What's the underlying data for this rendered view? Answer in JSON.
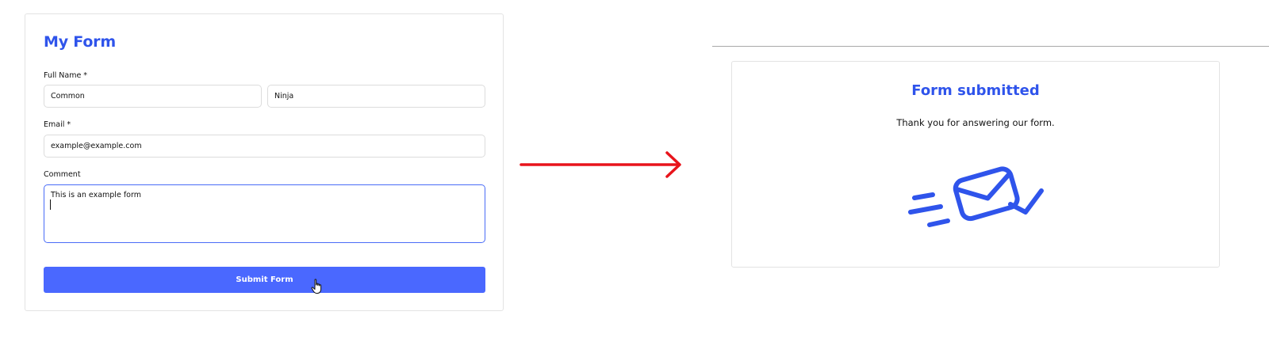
{
  "form": {
    "title": "My Form",
    "full_name_label": "Full Name *",
    "first_name_value": "Common",
    "last_name_value": "Ninja",
    "email_label": "Email *",
    "email_value": "example@example.com",
    "comment_label": "Comment",
    "comment_value": "This is an example form",
    "submit_label": "Submit Form"
  },
  "success": {
    "title": "Form submitted",
    "message": "Thank you for answering our form."
  },
  "colors": {
    "accent": "#2f54eb",
    "button": "#4a68ff",
    "arrow": "#e8141b"
  },
  "icons": {
    "cursor": "hand-pointer-icon",
    "arrow": "right-arrow-icon",
    "envelope": "envelope-sent-check-icon"
  }
}
